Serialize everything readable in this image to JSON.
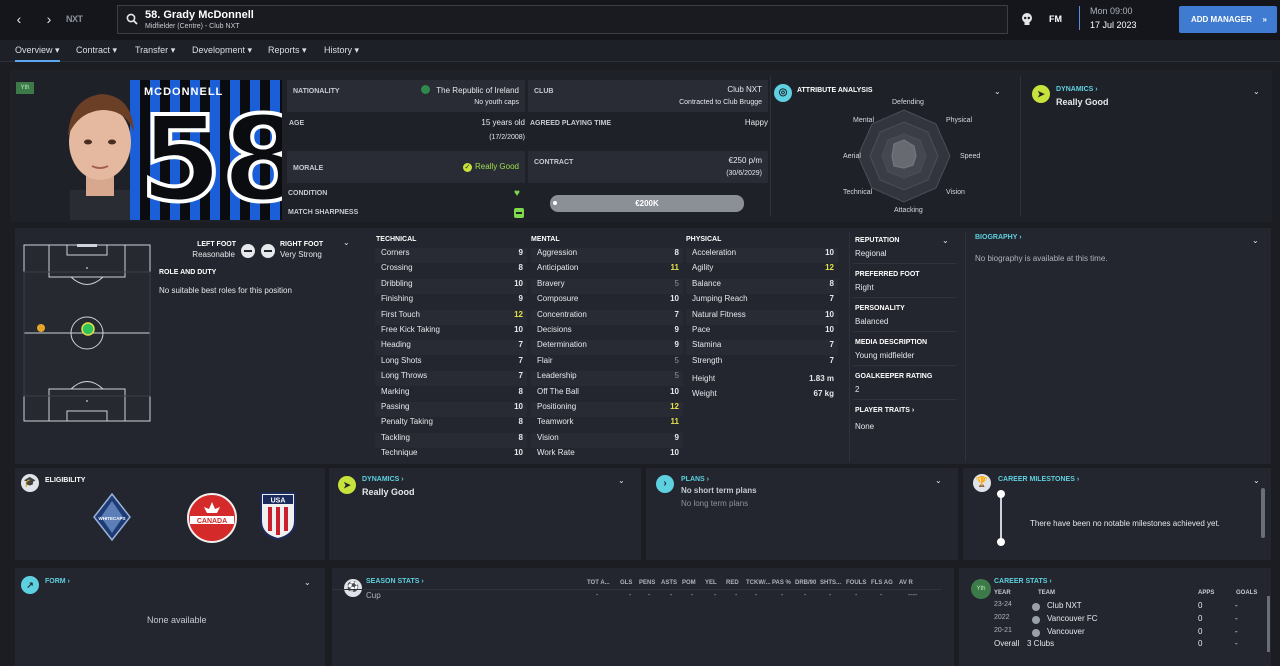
{
  "header": {
    "club_abbr": "NXT",
    "player_title": "58. Grady McDonnell",
    "player_sub": "Midfielder (Centre) - Club NXT",
    "fm_logo": "FM",
    "time": "Mon 09:00",
    "date": "17 Jul 2023",
    "add_manager": "ADD MANAGER"
  },
  "tabs": [
    "Overview",
    "Contract",
    "Transfer",
    "Development",
    "Reports",
    "History"
  ],
  "profile": {
    "badge": "Yth",
    "shirt_name": "MCDONNELL",
    "shirt_number": "58",
    "nationality_label": "NATIONALITY",
    "nationality": "The Republic of Ireland",
    "youth_caps": "No youth caps",
    "club_label": "CLUB",
    "club": "Club NXT",
    "club_sub": "Contracted to Club Brugge",
    "age_label": "AGE",
    "age": "15 years old",
    "dob": "(17/2/2008)",
    "playing_time_label": "AGREED PLAYING TIME",
    "playing_time": "Happy",
    "morale_label": "MORALE",
    "morale": "Really Good",
    "contract_label": "CONTRACT",
    "wage": "€250 p/m",
    "contract_end": "(30/6/2029)",
    "condition_label": "CONDITION",
    "sharpness_label": "MATCH SHARPNESS",
    "value": "€200K"
  },
  "attribute_analysis": {
    "title": "ATTRIBUTE ANALYSIS",
    "axes": [
      "Defending",
      "Physical",
      "Speed",
      "Vision",
      "Attacking",
      "Technical",
      "Aerial",
      "Mental"
    ]
  },
  "dynamics_top": {
    "title": "DYNAMICS",
    "value": "Really Good"
  },
  "position": {
    "left_foot_label": "LEFT FOOT",
    "left_foot": "Reasonable",
    "right_foot_label": "RIGHT FOOT",
    "right_foot": "Very Strong",
    "role_label": "ROLE AND DUTY",
    "role_text": "No suitable best roles for this position"
  },
  "technical": {
    "title": "TECHNICAL",
    "rows": [
      {
        "name": "Corners",
        "value": "9",
        "hl": ""
      },
      {
        "name": "Crossing",
        "value": "8",
        "hl": ""
      },
      {
        "name": "Dribbling",
        "value": "10",
        "hl": ""
      },
      {
        "name": "Finishing",
        "value": "9",
        "hl": ""
      },
      {
        "name": "First Touch",
        "value": "12",
        "hl": "yellow"
      },
      {
        "name": "Free Kick Taking",
        "value": "10",
        "hl": ""
      },
      {
        "name": "Heading",
        "value": "7",
        "hl": ""
      },
      {
        "name": "Long Shots",
        "value": "7",
        "hl": ""
      },
      {
        "name": "Long Throws",
        "value": "7",
        "hl": ""
      },
      {
        "name": "Marking",
        "value": "8",
        "hl": ""
      },
      {
        "name": "Passing",
        "value": "10",
        "hl": ""
      },
      {
        "name": "Penalty Taking",
        "value": "8",
        "hl": ""
      },
      {
        "name": "Tackling",
        "value": "8",
        "hl": ""
      },
      {
        "name": "Technique",
        "value": "10",
        "hl": ""
      }
    ]
  },
  "mental": {
    "title": "MENTAL",
    "rows": [
      {
        "name": "Aggression",
        "value": "8",
        "hl": ""
      },
      {
        "name": "Anticipation",
        "value": "11",
        "hl": "yellow"
      },
      {
        "name": "Bravery",
        "value": "5",
        "hl": "dim"
      },
      {
        "name": "Composure",
        "value": "10",
        "hl": ""
      },
      {
        "name": "Concentration",
        "value": "7",
        "hl": ""
      },
      {
        "name": "Decisions",
        "value": "9",
        "hl": ""
      },
      {
        "name": "Determination",
        "value": "9",
        "hl": ""
      },
      {
        "name": "Flair",
        "value": "5",
        "hl": "dim"
      },
      {
        "name": "Leadership",
        "value": "5",
        "hl": "dim"
      },
      {
        "name": "Off The Ball",
        "value": "10",
        "hl": ""
      },
      {
        "name": "Positioning",
        "value": "12",
        "hl": "yellow"
      },
      {
        "name": "Teamwork",
        "value": "11",
        "hl": "yellow"
      },
      {
        "name": "Vision",
        "value": "9",
        "hl": ""
      },
      {
        "name": "Work Rate",
        "value": "10",
        "hl": ""
      }
    ]
  },
  "physical": {
    "title": "PHYSICAL",
    "rows": [
      {
        "name": "Acceleration",
        "value": "10",
        "hl": ""
      },
      {
        "name": "Agility",
        "value": "12",
        "hl": "yellow"
      },
      {
        "name": "Balance",
        "value": "8",
        "hl": ""
      },
      {
        "name": "Jumping Reach",
        "value": "7",
        "hl": ""
      },
      {
        "name": "Natural Fitness",
        "value": "10",
        "hl": ""
      },
      {
        "name": "Pace",
        "value": "10",
        "hl": ""
      },
      {
        "name": "Stamina",
        "value": "7",
        "hl": ""
      },
      {
        "name": "Strength",
        "value": "7",
        "hl": ""
      }
    ],
    "height_label": "Height",
    "height": "1.83 m",
    "weight_label": "Weight",
    "weight": "67 kg"
  },
  "info": {
    "reputation_label": "REPUTATION",
    "reputation": "Regional",
    "foot_label": "PREFERRED FOOT",
    "foot": "Right",
    "personality_label": "PERSONALITY",
    "personality": "Balanced",
    "media_label": "MEDIA DESCRIPTION",
    "media": "Young midfielder",
    "gk_label": "GOALKEEPER RATING",
    "gk": "2",
    "traits_label": "PLAYER TRAITS",
    "traits": "None"
  },
  "biography": {
    "title": "BIOGRAPHY",
    "text": "No biography is available at this time."
  },
  "eligibility": {
    "title": "ELIGIBILITY",
    "logos": [
      {
        "name": "vancouver-whitecaps-logo",
        "text": "WHITECAPS"
      },
      {
        "name": "canada-logo",
        "text": "CANADA"
      },
      {
        "name": "usa-logo",
        "text": "USA"
      }
    ]
  },
  "dynamics_mid": {
    "title": "DYNAMICS",
    "value": "Really Good"
  },
  "plans": {
    "title": "PLANS",
    "short": "No short term plans",
    "long": "No long term plans"
  },
  "milestones": {
    "title": "CAREER MILESTONES",
    "text": "There have been no notable milestones achieved yet."
  },
  "form": {
    "title": "FORM",
    "text": "None available"
  },
  "season_stats": {
    "title": "SEASON STATS",
    "columns": [
      "TOT A...",
      "GLS",
      "PENS",
      "ASTS",
      "POM",
      "YEL",
      "RED",
      "TCKW/...",
      "PAS %",
      "DRB/90",
      "SHTS...",
      "FOULS",
      "FLS AG",
      "AV R"
    ],
    "row_label": "Cup",
    "row_values": [
      "-",
      "-",
      "-",
      "-",
      "-",
      "-",
      "-",
      "-",
      "-",
      "-",
      "-",
      "-",
      "-",
      "----"
    ]
  },
  "career_stats": {
    "title": "CAREER STATS",
    "badge": "Yth",
    "head": {
      "year": "YEAR",
      "team": "TEAM",
      "apps": "APPS",
      "goals": "GOALS"
    },
    "rows": [
      {
        "year": "23-24",
        "team": "Club NXT",
        "apps": "0",
        "goals": "-"
      },
      {
        "year": "2022",
        "team": "Vancouver FC",
        "apps": "0",
        "goals": "-"
      },
      {
        "year": "20-21",
        "team": "Vancouver",
        "apps": "0",
        "goals": "-"
      }
    ],
    "overall_label": "Overall",
    "overall_team": "3 Clubs",
    "overall_apps": "0",
    "overall_goals": "-"
  },
  "colors": {
    "accent": "#3e7bd1",
    "highlight": "#e5e14a",
    "positive": "#9fe04a",
    "link": "#5ed1e0"
  }
}
